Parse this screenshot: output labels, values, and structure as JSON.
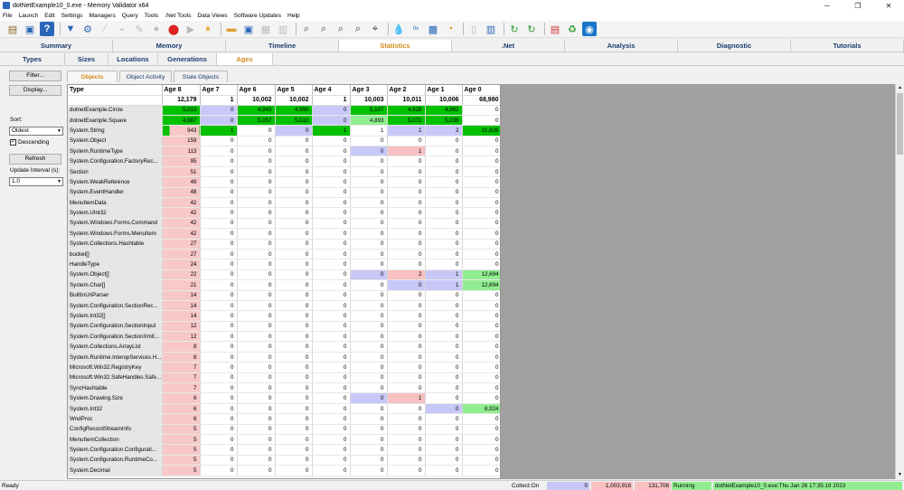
{
  "window": {
    "title": "dotNetExample10_0.exe - Memory Validator x64"
  },
  "menu": [
    "File",
    "Launch",
    "Edit",
    "Settings",
    "Managers",
    "Query",
    "Tools",
    ".Net Tools",
    "Data Views",
    "Software Updates",
    "Help"
  ],
  "main_tabs": [
    {
      "label": "Summary",
      "active": false
    },
    {
      "label": "Memory",
      "active": false
    },
    {
      "label": "Timeline",
      "active": false
    },
    {
      "label": "Statistics",
      "active": true
    },
    {
      "label": ".Net",
      "active": false
    },
    {
      "label": "Analysis",
      "active": false
    },
    {
      "label": "Diagnostic",
      "active": false
    },
    {
      "label": "Tutorials",
      "active": false
    }
  ],
  "stat_tabs": [
    {
      "label": "Types",
      "active": false
    },
    {
      "label": "Sizes",
      "active": false
    },
    {
      "label": "Locations",
      "active": false
    },
    {
      "label": "Generations",
      "active": false
    },
    {
      "label": "Ages",
      "active": true
    }
  ],
  "sidebar": {
    "filter_label": "Filter...",
    "display_label": "Display...",
    "sort_label": "Sort:",
    "sort_value": "Oldest",
    "descending_label": "Descending",
    "descending_checked": true,
    "refresh_label": "Refresh",
    "interval_label": "Update Interval (s):",
    "interval_value": "1.0"
  },
  "sub_tabs": [
    {
      "label": "Objects",
      "active": true
    },
    {
      "label": "Object Activity",
      "active": false
    },
    {
      "label": "Stale Objects",
      "active": false
    }
  ],
  "table": {
    "headers": [
      "Type",
      "Age 8",
      "Age 7",
      "Age 6",
      "Age 5",
      "Age 4",
      "Age 3",
      "Age 2",
      "Age 1",
      "Age 0"
    ],
    "totals": [
      "12,179",
      "1",
      "10,002",
      "10,002",
      "1",
      "10,003",
      "10,011",
      "10,006",
      "68,980"
    ],
    "rows": [
      [
        "dotnetExample.Circle",
        "5,013",
        "0",
        "4,943",
        "4,990",
        "0",
        "5,107",
        "4,928",
        "4,962",
        "0"
      ],
      [
        "dotnetExample.Square",
        "4,987",
        "0",
        "5,057",
        "5,010",
        "0",
        "4,893",
        "5,072",
        "5,038",
        "0"
      ],
      [
        "System.String",
        "943",
        "1",
        "0",
        "0",
        "1",
        "1",
        "1",
        "2",
        "21,828"
      ],
      [
        "System.Object",
        "159",
        "0",
        "0",
        "0",
        "0",
        "0",
        "0",
        "0",
        "0"
      ],
      [
        "System.RuntimeType",
        "113",
        "0",
        "0",
        "0",
        "0",
        "0",
        "1",
        "0",
        "0"
      ],
      [
        "System.Configuration.FactoryRec...",
        "95",
        "0",
        "0",
        "0",
        "0",
        "0",
        "0",
        "0",
        "0"
      ],
      [
        "Section",
        "51",
        "0",
        "0",
        "0",
        "0",
        "0",
        "0",
        "0",
        "0"
      ],
      [
        "System.WeakReference",
        "49",
        "0",
        "0",
        "0",
        "0",
        "0",
        "0",
        "0",
        "0"
      ],
      [
        "System.EventHandler",
        "48",
        "0",
        "0",
        "0",
        "0",
        "0",
        "0",
        "0",
        "0"
      ],
      [
        "MenuItemData",
        "42",
        "0",
        "0",
        "0",
        "0",
        "0",
        "0",
        "0",
        "0"
      ],
      [
        "System.UInt32",
        "42",
        "0",
        "0",
        "0",
        "0",
        "0",
        "0",
        "0",
        "0"
      ],
      [
        "System.Windows.Forms.Command",
        "42",
        "0",
        "0",
        "0",
        "0",
        "0",
        "0",
        "0",
        "0"
      ],
      [
        "System.Windows.Forms.MenuItem",
        "42",
        "0",
        "0",
        "0",
        "0",
        "0",
        "0",
        "0",
        "0"
      ],
      [
        "System.Collections.Hashtable",
        "27",
        "0",
        "0",
        "0",
        "0",
        "0",
        "0",
        "0",
        "0"
      ],
      [
        "bucket[]",
        "27",
        "0",
        "0",
        "0",
        "0",
        "0",
        "0",
        "0",
        "0"
      ],
      [
        "HandleType",
        "24",
        "0",
        "0",
        "0",
        "0",
        "0",
        "0",
        "0",
        "0"
      ],
      [
        "System.Object[]",
        "22",
        "0",
        "0",
        "0",
        "0",
        "0",
        "2",
        "1",
        "12,694"
      ],
      [
        "System.Char[]",
        "21",
        "0",
        "0",
        "0",
        "0",
        "0",
        "0",
        "1",
        "12,694"
      ],
      [
        "BuiltInUriParser",
        "14",
        "0",
        "0",
        "0",
        "0",
        "0",
        "0",
        "0",
        "0"
      ],
      [
        "System.Configuration.SectionRec...",
        "14",
        "0",
        "0",
        "0",
        "0",
        "0",
        "0",
        "0",
        "0"
      ],
      [
        "System.Int32[]",
        "14",
        "0",
        "0",
        "0",
        "0",
        "0",
        "0",
        "0",
        "0"
      ],
      [
        "System.Configuration.SectionInput",
        "12",
        "0",
        "0",
        "0",
        "0",
        "0",
        "0",
        "0",
        "0"
      ],
      [
        "System.Configuration.SectionXmlI...",
        "12",
        "0",
        "0",
        "0",
        "0",
        "0",
        "0",
        "0",
        "0"
      ],
      [
        "System.Collections.ArrayList",
        "8",
        "0",
        "0",
        "0",
        "0",
        "0",
        "0",
        "0",
        "0"
      ],
      [
        "System.Runtime.InteropServices.H...",
        "8",
        "0",
        "0",
        "0",
        "0",
        "0",
        "0",
        "0",
        "0"
      ],
      [
        "Microsoft.Win32.RegistryKey",
        "7",
        "0",
        "0",
        "0",
        "0",
        "0",
        "0",
        "0",
        "0"
      ],
      [
        "Microsoft.Win32.SafeHandles.Safe...",
        "7",
        "0",
        "0",
        "0",
        "0",
        "0",
        "0",
        "0",
        "0"
      ],
      [
        "SyncHashtable",
        "7",
        "0",
        "0",
        "0",
        "0",
        "0",
        "0",
        "0",
        "0"
      ],
      [
        "System.Drawing.Size",
        "6",
        "0",
        "0",
        "0",
        "0",
        "0",
        "1",
        "0",
        "0"
      ],
      [
        "System.Int32",
        "6",
        "0",
        "0",
        "0",
        "0",
        "0",
        "0",
        "0",
        "8,924"
      ],
      [
        "WndProc",
        "6",
        "0",
        "0",
        "0",
        "0",
        "0",
        "0",
        "0",
        "0"
      ],
      [
        "ConfigRecordStreamInfo",
        "5",
        "0",
        "0",
        "0",
        "0",
        "0",
        "0",
        "0",
        "0"
      ],
      [
        "MenuItemCollection",
        "5",
        "0",
        "0",
        "0",
        "0",
        "0",
        "0",
        "0",
        "0"
      ],
      [
        "System.Configuration.Configurati...",
        "5",
        "0",
        "0",
        "0",
        "0",
        "0",
        "0",
        "0",
        "0"
      ],
      [
        "System.Configuration.RuntimeCo...",
        "5",
        "0",
        "0",
        "0",
        "0",
        "0",
        "0",
        "0",
        "0"
      ],
      [
        "System.Decimal",
        "5",
        "0",
        "0",
        "0",
        "0",
        "0",
        "0",
        "0",
        "0"
      ]
    ],
    "cell_colors": {
      "0": {
        "1": "#00c000",
        "2": "#c8c8f8",
        "3": "#00c000",
        "4": "#00c000",
        "5": "#c8c8f8",
        "6": "#00c000",
        "7": "#00c000",
        "8": "#00c000"
      },
      "1": {
        "1": "#00c000",
        "2": "#c8c8f8",
        "3": "#00c000",
        "4": "#00c000",
        "5": "#c8c8f8",
        "6": "#90ee90",
        "7": "#00c000",
        "8": "#00c000"
      },
      "2": {
        "2": "#00c000",
        "4": "#c8c8f8",
        "5": "#00c000",
        "7": "#c8c8f8",
        "8": "#c8c8f8",
        "9": "#00c000"
      },
      "4": {
        "6": "#c8c8f8",
        "7": "#f8c0c0"
      },
      "16": {
        "6": "#c8c8f8",
        "7": "#f8c0c0",
        "8": "#c8c8f8",
        "9": "#90ee90"
      },
      "17": {
        "7": "#c8c8f8",
        "8": "#c8c8f8",
        "9": "#90ee90"
      },
      "28": {
        "6": "#c8c8f8",
        "7": "#f8c0c0"
      },
      "29": {
        "8": "#c8c8f8",
        "9": "#90ee90"
      }
    },
    "age8_fill": "#f8c8c8",
    "age8_bar_color": "#00c000"
  },
  "status": {
    "ready": "Ready",
    "collect": "Collect:On",
    "c1": "0",
    "c2": "1,003,916",
    "c3": "131,706",
    "running": "Running",
    "process": "dotNetExample10_0.exe:Thu Jan 26 17:35:19 2023"
  },
  "colors": {
    "active_tab": "#d28a1c",
    "tab_text": "#1b3b6f",
    "empty_area": "#a0a0a0"
  }
}
